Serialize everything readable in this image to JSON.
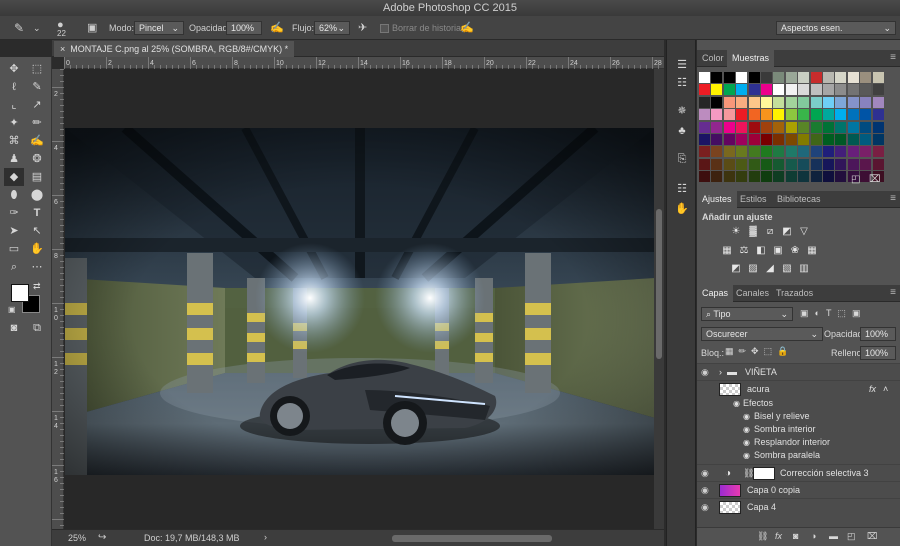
{
  "app": {
    "title": "Adobe Photoshop CC 2015"
  },
  "options": {
    "brush_size": "22",
    "mode_label": "Modo:",
    "mode_value": "Pincel",
    "opacity_label": "Opacidad:",
    "opacity_value": "100%",
    "flow_label": "Flujo:",
    "flow_value": "62%",
    "erase_history": "Borrar de historia",
    "workspace": "Aspectos esen."
  },
  "document": {
    "tab": "MONTAJE C.png al 25% (SOMBRA, RGB/8#/CMYK) *",
    "ruler_h": [
      "0",
      "2",
      "4",
      "6",
      "8",
      "10",
      "12",
      "14",
      "16",
      "18",
      "20",
      "22",
      "24",
      "26",
      "28"
    ],
    "ruler_v": [
      "2",
      "4",
      "6",
      "8",
      "1\n0",
      "1\n2",
      "1\n4",
      "1\n6"
    ]
  },
  "status": {
    "zoom": "25%",
    "doc": "Doc: 19,7 MB/148,3 MB"
  },
  "color_panel": {
    "tabs": [
      "Color",
      "Muestras"
    ]
  },
  "adjust_panel": {
    "tabs": [
      "Ajustes",
      "Estilos",
      "Bibliotecas"
    ],
    "heading": "Añadir un ajuste"
  },
  "layers_panel": {
    "tabs": [
      "Capas",
      "Canales",
      "Trazados"
    ],
    "filter": "Tipo",
    "blend": "Oscurecer",
    "opacity_label": "Opacidad:",
    "opacity_value": "100%",
    "lock_label": "Bloq.:",
    "fill_label": "Relleno:",
    "fill_value": "100%",
    "layers": [
      {
        "name": "VIÑETA"
      },
      {
        "name": "acura",
        "fx": "fx"
      },
      {
        "name": "Efectos"
      },
      {
        "name": "Bisel y relieve"
      },
      {
        "name": "Sombra interior"
      },
      {
        "name": "Resplandor interior"
      },
      {
        "name": "Sombra paralela"
      },
      {
        "name": "Corrección selectiva 3"
      },
      {
        "name": "Capa 0 copia"
      },
      {
        "name": "Capa 4"
      }
    ]
  },
  "colors": {
    "accent": "#3e7bd6",
    "panel": "#535353",
    "dark": "#2b2b2b"
  },
  "icons": [
    "eraser-icon",
    "brush-preset-icon",
    "airbrush-icon",
    "eye-icon",
    "folder-icon",
    "link-icon",
    "trash-icon",
    "new-layer-icon"
  ]
}
